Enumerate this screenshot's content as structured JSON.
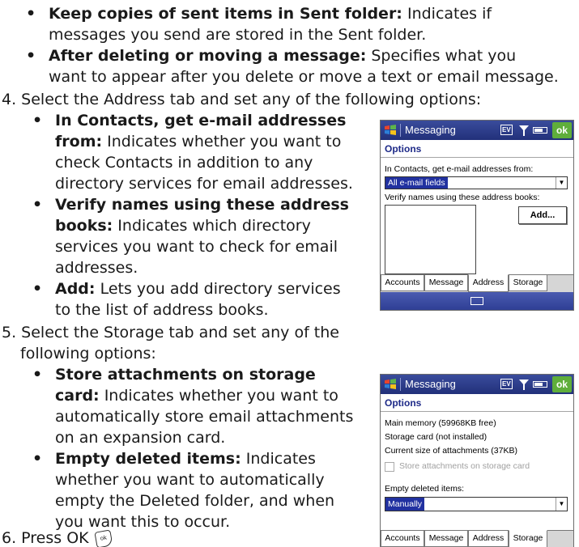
{
  "doc": {
    "sent_items_bold": "Keep copies of sent items in Sent folder:",
    "sent_items_desc_1": "Indicates if",
    "sent_items_desc_2": "messages you send are stored in the Sent folder.",
    "after_delete_bold": "After deleting or moving a message:",
    "after_delete_desc_1": "Specifies what you",
    "after_delete_desc_2": "want to appear after you delete or move a text or email message.",
    "step4": "4. Select the Address tab and set any of the following options:",
    "contacts_bold_1": "In Contacts, get e-mail addresses",
    "contacts_bold_2": "from:",
    "contacts_desc_1": "Indicates whether you want to",
    "contacts_desc_2": "check Contacts in addition to any",
    "contacts_desc_3": "directory services for email addresses.",
    "verify_bold_1": "Verify names using these address",
    "verify_bold_2": "books:",
    "verify_desc_1": "Indicates which directory",
    "verify_desc_2": "services you want to check for email",
    "verify_desc_3": "addresses.",
    "add_bold": "Add:",
    "add_desc_1": "Lets you add directory services",
    "add_desc_2": "to the list of address books.",
    "step5_1": "5. Select the Storage tab and set any of the",
    "step5_2": "following options:",
    "store_bold_1": "Store attachments on storage",
    "store_bold_2": "card:",
    "store_desc_1": "Indicates whether you want to",
    "store_desc_2": "automatically store email attachments",
    "store_desc_3": "on an expansion card.",
    "empty_bold": "Empty deleted items:",
    "empty_desc_1": "Indicates",
    "empty_desc_2": "whether you want to automatically",
    "empty_desc_3": "empty the Deleted folder, and when",
    "empty_desc_4": "you want this to occur.",
    "step6": "6. Press OK",
    "ok_glyph_text": "ok",
    "bullet": "•"
  },
  "screen1": {
    "app": "Messaging",
    "ev": "EV",
    "ok": "ok",
    "subtitle": "Options",
    "contacts_label": "In Contacts, get e-mail addresses from:",
    "contacts_value": "All e-mail fields",
    "verify_label": "Verify names using these address books:",
    "add_button": "Add...",
    "tabs": [
      "Accounts",
      "Message",
      "Address",
      "Storage"
    ]
  },
  "screen2": {
    "app": "Messaging",
    "ev": "EV",
    "ok": "ok",
    "subtitle": "Options",
    "main_memory": "Main memory (59968KB free)",
    "storage_card": "Storage card (not installed)",
    "attachments_size": "Current size of attachments (37KB)",
    "store_checkbox": "Store attachments on storage card",
    "empty_label": "Empty deleted items:",
    "empty_value": "Manually",
    "tabs": [
      "Accounts",
      "Message",
      "Address",
      "Storage"
    ]
  },
  "colors": {
    "title_bar": "#2a3a8a",
    "ok_button": "#5fae3b",
    "selection": "#2131a0",
    "subtitle": "#1e2a88"
  },
  "icons": [
    "windows-flag-icon",
    "signal-icon",
    "battery-icon",
    "keyboard-icon",
    "dropdown-arrow-icon",
    "ok-key-icon"
  ]
}
